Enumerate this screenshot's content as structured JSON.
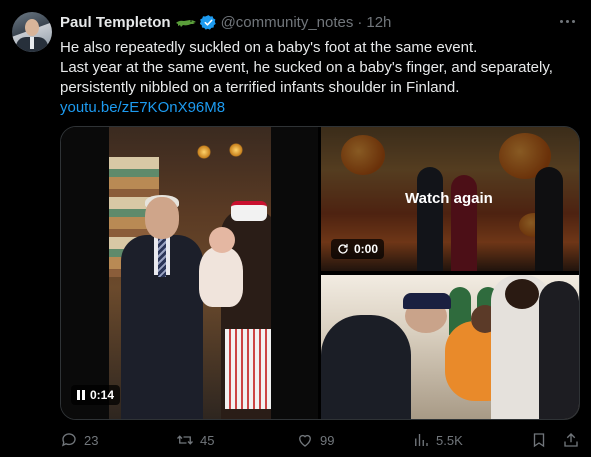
{
  "author": {
    "name": "Paul Templeton",
    "handle": "@community_notes",
    "separator": "·",
    "time": "12h",
    "badge_icon": "crocodile-emoji"
  },
  "tweet": {
    "line1": "He also repeatedly suckled on a baby's foot at the same event.",
    "line2": "Last year at the same event, he sucked on a baby's finger, and separately, persistently nibbled on a terrified infants shoulder in Finland.",
    "link": "youtu.be/zE7KOnX96M8"
  },
  "media": {
    "video_left_time": "0:14",
    "video_tr_time": "0:00",
    "watch_again": "Watch again"
  },
  "actions": {
    "replies": "23",
    "reposts": "45",
    "likes": "99",
    "views": "5.5K"
  },
  "colors": {
    "background": "#000000",
    "text": "#e7e9ea",
    "muted": "#71767b",
    "link": "#1d9bf0",
    "verified": "#1d9bf0"
  }
}
